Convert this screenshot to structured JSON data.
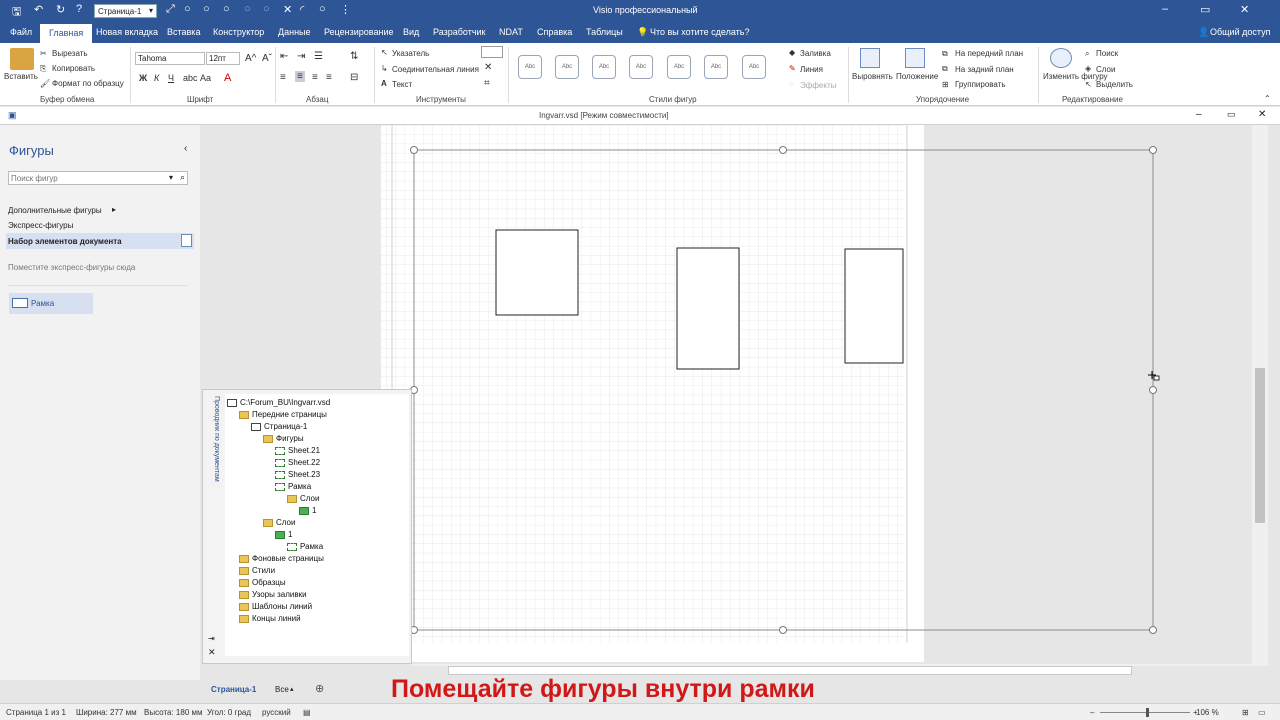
{
  "window": {
    "title": "Visio профессиональный",
    "doc_title": "Ingvarr.vsd  [Режим совместимости]"
  },
  "quick_access": {
    "page_dropdown": "Страница-1"
  },
  "tabs": [
    "Файл",
    "Главная",
    "Новая вкладка",
    "Вставка",
    "Конструктор",
    "Данные",
    "Рецензирование",
    "Вид",
    "Разработчик",
    "NDAT",
    "Справка",
    "Таблицы"
  ],
  "tell_me": "Что вы хотите сделать?",
  "share": "Общий доступ",
  "ribbon": {
    "clipboard": {
      "paste": "Вставить",
      "cut": "Вырезать",
      "copy": "Копировать",
      "format_painter": "Формат по образцу",
      "group": "Буфер обмена"
    },
    "font": {
      "name": "Tahoma",
      "size": "12пт",
      "group": "Шрифт",
      "bold": "Ж",
      "italic": "К",
      "underline": "Ч"
    },
    "paragraph": {
      "group": "Абзац"
    },
    "tools": {
      "pointer": "Указатель",
      "connector": "Соединительная линия",
      "text": "Текст",
      "group": "Инструменты"
    },
    "shape_styles": {
      "group": "Стили фигур",
      "sample": "Abc",
      "fill": "Заливка",
      "line": "Линия",
      "effects": "Эффекты"
    },
    "arrange": {
      "align": "Выровнять",
      "position": "Положение",
      "bring_front": "На передний план",
      "send_back": "На задний план",
      "group_btn": "Группировать",
      "group": "Упорядочение"
    },
    "editing": {
      "change_shape": "Изменить фигуру",
      "find": "Поиск",
      "layers": "Слои",
      "select": "Выделить",
      "group": "Редактирование"
    }
  },
  "shapes_pane": {
    "title": "Фигуры",
    "search_placeholder": "Поиск фигур",
    "more_shapes": "Дополнительные фигуры",
    "quick_shapes": "Экспресс-фигуры",
    "doc_stencil": "Набор элементов документа",
    "hint": "Поместите экспресс-фигуры сюда",
    "frame_shape": "Рамка"
  },
  "explorer": {
    "side_title": "Проводник по документам",
    "tree": [
      {
        "label": "C:\\Forum_BU\\Ingvarr.vsd",
        "level": 0,
        "kind": "doc"
      },
      {
        "label": "Передние страницы",
        "level": 1,
        "kind": "folder"
      },
      {
        "label": "Страница-1",
        "level": 2,
        "kind": "page"
      },
      {
        "label": "Фигуры",
        "level": 3,
        "kind": "folder"
      },
      {
        "label": "Sheet.21",
        "level": 4,
        "kind": "shape"
      },
      {
        "label": "Sheet.22",
        "level": 4,
        "kind": "shape"
      },
      {
        "label": "Sheet.23",
        "level": 4,
        "kind": "shape"
      },
      {
        "label": "Рамка",
        "level": 4,
        "kind": "shape"
      },
      {
        "label": "Слои",
        "level": 5,
        "kind": "folder"
      },
      {
        "label": "1",
        "level": 6,
        "kind": "layer"
      },
      {
        "label": "Слои",
        "level": 3,
        "kind": "folder"
      },
      {
        "label": "1",
        "level": 4,
        "kind": "layer"
      },
      {
        "label": "Рамка",
        "level": 5,
        "kind": "shape"
      },
      {
        "label": "Фоновые страницы",
        "level": 1,
        "kind": "folder"
      },
      {
        "label": "Стили",
        "level": 1,
        "kind": "folder"
      },
      {
        "label": "Образцы",
        "level": 1,
        "kind": "folder"
      },
      {
        "label": "Узоры заливки",
        "level": 1,
        "kind": "folder"
      },
      {
        "label": "Шаблоны линий",
        "level": 1,
        "kind": "folder"
      },
      {
        "label": "Концы линий",
        "level": 1,
        "kind": "folder"
      }
    ]
  },
  "page_tabs": {
    "current": "Страница-1",
    "all": "Все"
  },
  "status": {
    "page": "Страница 1 из 1",
    "width": "Ширина: 277 мм",
    "height": "Высота: 180 мм",
    "angle": "Угол: 0 град",
    "lang": "русский",
    "zoom": "106 %"
  },
  "caption": "Помещайте фигуры внутри рамки",
  "colors": {
    "accent": "#2e5596",
    "caption": "#d01818"
  }
}
